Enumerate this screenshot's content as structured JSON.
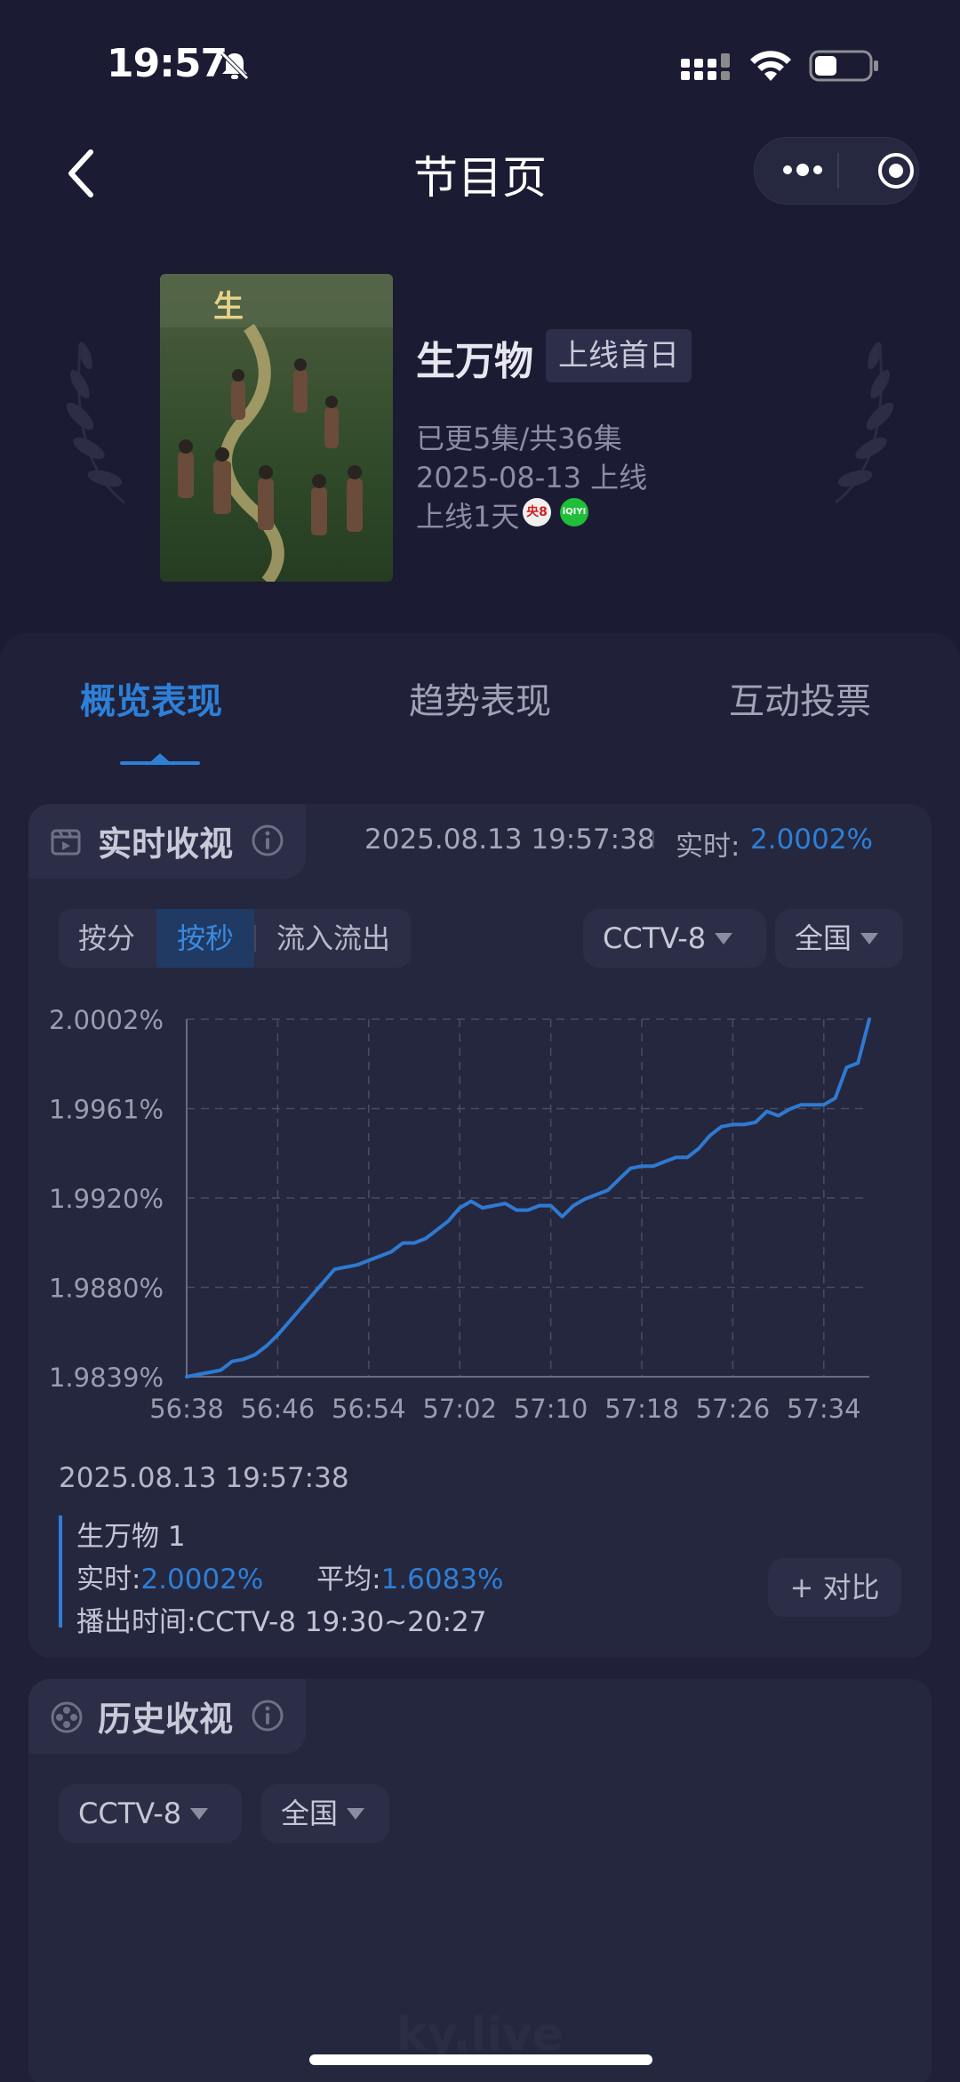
{
  "status_bar": {
    "time": "19:57"
  },
  "nav": {
    "title": "节目页"
  },
  "show": {
    "title": "生万物",
    "badge": "上线首日",
    "episodes": "已更5集/共36集",
    "release": "2025-08-13 上线",
    "days_online": "上线1天",
    "platforms": [
      "央8",
      "iQIYI"
    ]
  },
  "tabs": [
    "概览表现",
    "趋势表现",
    "互动投票"
  ],
  "realtime": {
    "title": "实时收视",
    "timestamp": "2025.08.13 19:57:38",
    "label": "实时:",
    "value": "2.0002%",
    "segments": [
      "按分",
      "按秒",
      "流入流出"
    ],
    "channel": "CCTV-8",
    "region": "全国"
  },
  "chart_data": {
    "type": "line",
    "color": "#2f7ad1",
    "x_ticks": [
      "56:38",
      "56:46",
      "56:54",
      "57:02",
      "57:10",
      "57:18",
      "57:26",
      "57:34"
    ],
    "y_ticks": [
      "2.0002%",
      "1.9961%",
      "1.9920%",
      "1.9880%",
      "1.9839%"
    ],
    "ylim": [
      1.9839,
      2.0002
    ],
    "grid": true,
    "series": [
      {
        "x": [
          0,
          1,
          2,
          3,
          4,
          5,
          6,
          7,
          8,
          9,
          10,
          11,
          12,
          13,
          14,
          15,
          16,
          17,
          18,
          19,
          20,
          21,
          22,
          23,
          24,
          25,
          26,
          27,
          28,
          29,
          30,
          31,
          32,
          33,
          34,
          35,
          36,
          37,
          38,
          39,
          40,
          41,
          42,
          43,
          44,
          45,
          46,
          47,
          48,
          49,
          50,
          51,
          52,
          53,
          54,
          55,
          56,
          57,
          58,
          59,
          60
        ],
        "values": [
          1.9839,
          1.984,
          1.9841,
          1.9842,
          1.9846,
          1.9847,
          1.9849,
          1.9853,
          1.9858,
          1.9864,
          1.987,
          1.9876,
          1.9882,
          1.9888,
          1.9889,
          1.989,
          1.9892,
          1.9894,
          1.9896,
          1.99,
          1.99,
          1.9902,
          1.9906,
          1.991,
          1.9916,
          1.9919,
          1.9916,
          1.9917,
          1.9918,
          1.9915,
          1.9915,
          1.9917,
          1.9917,
          1.9912,
          1.9917,
          1.992,
          1.9922,
          1.9924,
          1.9929,
          1.9934,
          1.9935,
          1.9935,
          1.9937,
          1.9939,
          1.9939,
          1.9943,
          1.9949,
          1.9953,
          1.9954,
          1.9954,
          1.9955,
          1.996,
          1.9958,
          1.9961,
          1.9963,
          1.9963,
          1.9963,
          1.9966,
          1.998,
          1.9982,
          2.0002
        ]
      }
    ]
  },
  "info": {
    "timestamp": "2025.08.13 19:57:38",
    "episode": "生万物 1",
    "realtime_label": "实时:",
    "realtime_value": "2.0002%",
    "average_label": "平均:",
    "average_value": "1.6083%",
    "airtime_label": "播出时间:",
    "airtime_value": "CCTV-8 19:30~20:27",
    "compare_button": "+ 对比"
  },
  "history": {
    "title": "历史收视",
    "channel": "CCTV-8",
    "region": "全国"
  },
  "watermark": "ky.live"
}
